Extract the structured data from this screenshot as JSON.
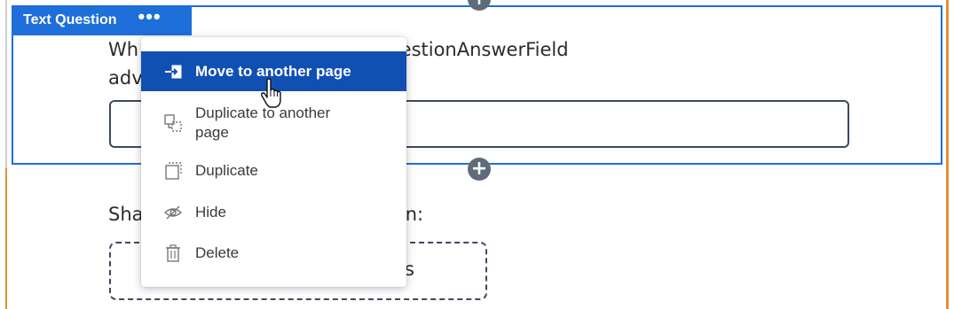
{
  "question_block": {
    "type_label": "Text Question",
    "more_icon": "more-horizontal-icon",
    "text_line1": "Wh                            xampleQuestionAnswerField",
    "text_line2": "adv"
  },
  "second_block": {
    "text": "Sha                              have seen:",
    "box_text": "s"
  },
  "add_button_label": "+",
  "context_menu": {
    "items": [
      {
        "label": "Move to another page",
        "icon": "move-page-icon",
        "active": true
      },
      {
        "label": "Duplicate to another\npage",
        "icon": "duplicate-to-page-icon"
      },
      {
        "label": "Duplicate",
        "icon": "duplicate-icon"
      },
      {
        "label": "Hide",
        "icon": "hide-eye-icon"
      },
      {
        "label": "Delete",
        "icon": "trash-icon"
      }
    ]
  },
  "colors": {
    "selection_blue": "#1e6fd9",
    "menu_active": "#1150b3",
    "section_orange": "#e0913a"
  }
}
